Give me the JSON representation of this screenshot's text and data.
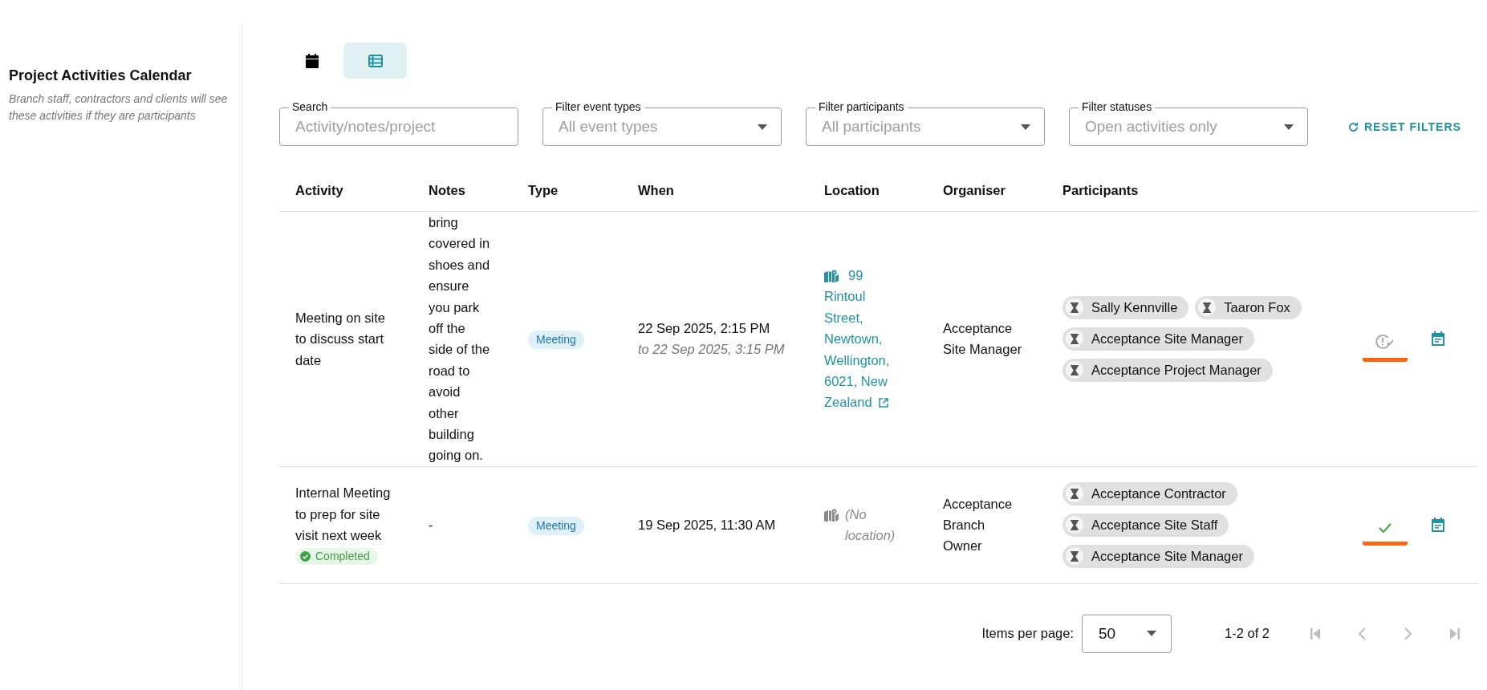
{
  "sidebar": {
    "title": "Project Activities Calendar",
    "subtitle": "Branch staff, contractors and clients will see these activities if they are participants"
  },
  "view_toggle": [
    {
      "kind": "calendar",
      "selected": false
    },
    {
      "kind": "list",
      "selected": true
    }
  ],
  "filters": [
    {
      "kind": "text",
      "label": "Search",
      "placeholder": "Activity/notes/project"
    },
    {
      "kind": "select",
      "label": "Filter event types",
      "placeholder": "All event types"
    },
    {
      "kind": "select",
      "label": "Filter participants",
      "placeholder": "All participants"
    },
    {
      "kind": "select",
      "label": "Filter statuses",
      "placeholder": "Open activities only"
    }
  ],
  "reset_button": "RESET FILTERS",
  "table": {
    "columns": [
      "Activity",
      "Notes",
      "Type",
      "When",
      "Location",
      "Organiser",
      "Participants"
    ],
    "rows": [
      {
        "activity": "Meeting on site to discuss start date",
        "completed_badge": null,
        "notes": "bring covered in shoes and ensure you park off the side of the road to avoid other building going on.",
        "type": "Meeting",
        "when": "22 Sep 2025, 2:15 PM",
        "when_end": "to 22 Sep 2025, 3:15 PM",
        "location": "99 Rintoul Street, Newtown, Wellington, 6021, New Zealand",
        "has_location": true,
        "organiser": "Acceptance Site Manager",
        "participants": [
          "Sally Kennville",
          "Taaron Fox",
          "Acceptance Site Manager",
          "Acceptance Project Manager"
        ],
        "completed": false
      },
      {
        "activity": "Internal Meeting to prep for site visit next week",
        "completed_badge": "Completed",
        "notes": "-",
        "type": "Meeting",
        "when": "19 Sep 2025, 11:30 AM",
        "when_end": null,
        "location": "(No location)",
        "has_location": false,
        "organiser": "Acceptance Branch Owner",
        "participants": [
          "Acceptance Contractor",
          "Acceptance Site Staff",
          "Acceptance Site Manager"
        ],
        "completed": true
      }
    ]
  },
  "pagination": {
    "items_per_page_label": "Items per page:",
    "items_per_page": "50",
    "range": "1-2 of 2",
    "buttons": [
      {
        "kind": "first",
        "disabled": true
      },
      {
        "kind": "prev",
        "disabled": true
      },
      {
        "kind": "next",
        "disabled": true
      },
      {
        "kind": "last",
        "disabled": true
      }
    ]
  }
}
